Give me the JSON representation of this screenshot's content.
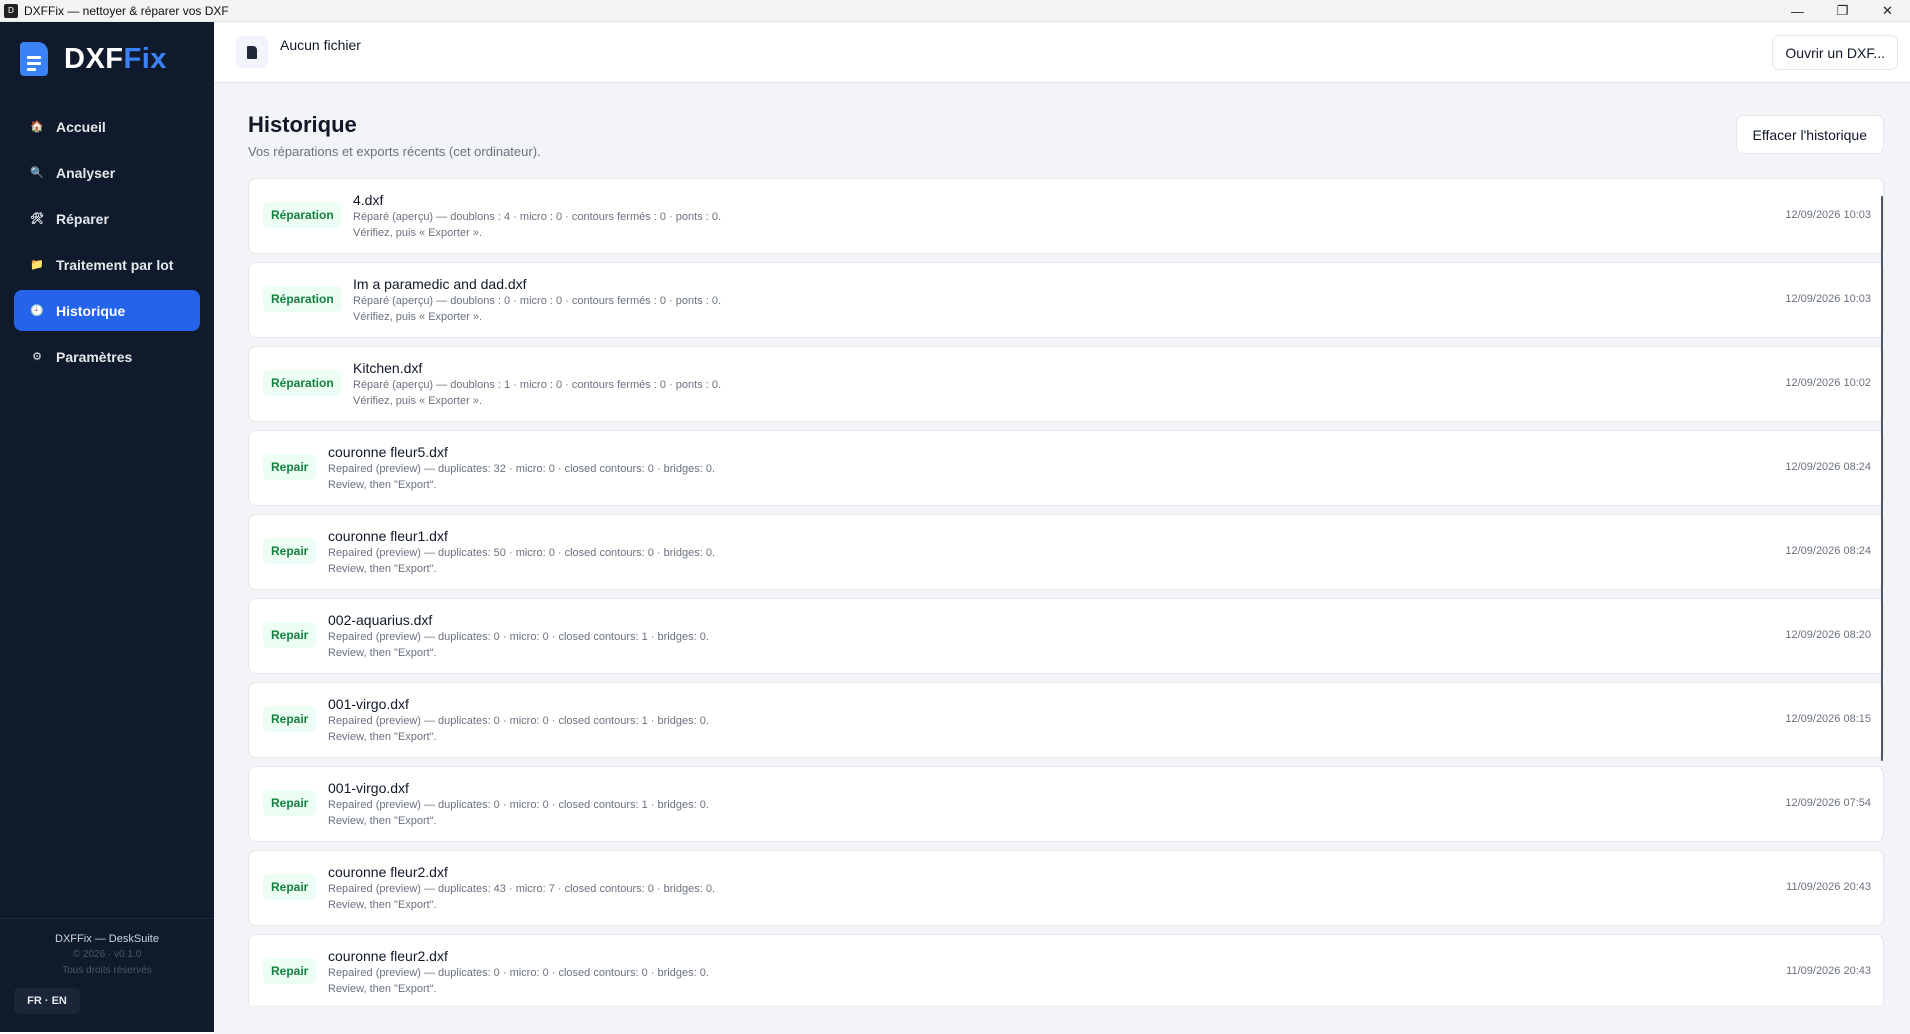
{
  "window": {
    "title": "DXFFix — nettoyer & réparer vos DXF",
    "app_icon": "D",
    "minimize": "—",
    "maximize": "❐",
    "close": "✕"
  },
  "logo": {
    "part1": "DXF",
    "part2": "Fix"
  },
  "nav": [
    {
      "label": "Accueil",
      "icon": "🏠"
    },
    {
      "label": "Analyser",
      "icon": "🔍"
    },
    {
      "label": "Réparer",
      "icon": "🛠"
    },
    {
      "label": "Traitement par lot",
      "icon": "📁"
    },
    {
      "label": "Historique",
      "icon": "🕘",
      "active": true
    },
    {
      "label": "Paramètres",
      "icon": "⚙"
    }
  ],
  "footer": {
    "name": "DXFFix — DeskSuite",
    "version": "© 2026 · v0.1.0",
    "rights": "Tous droits réservés",
    "lang": "FR · EN"
  },
  "topbar": {
    "file_label": "Aucun fichier",
    "open_button": "Ouvrir un DXF..."
  },
  "page": {
    "title": "Historique",
    "subtitle": "Vos réparations et exports récents (cet ordinateur).",
    "clear_button": "Effacer l'historique"
  },
  "history": [
    {
      "badge": "Réparation",
      "file": "4.dxf",
      "line1": "Réparé (aperçu) — doublons : 4 · micro : 0 · contours fermés : 0 · ponts : 0.",
      "line2": "Vérifiez, puis « Exporter ».",
      "time": "12/09/2026 10:03"
    },
    {
      "badge": "Réparation",
      "file": "Im a paramedic and dad.dxf",
      "line1": "Réparé (aperçu) — doublons : 0 · micro : 0 · contours fermés : 0 · ponts : 0.",
      "line2": "Vérifiez, puis « Exporter ».",
      "time": "12/09/2026 10:03"
    },
    {
      "badge": "Réparation",
      "file": "Kitchen.dxf",
      "line1": "Réparé (aperçu) — doublons : 1 · micro : 0 · contours fermés : 0 · ponts : 0.",
      "line2": "Vérifiez, puis « Exporter ».",
      "time": "12/09/2026 10:02"
    },
    {
      "badge": "Repair",
      "file": "couronne fleur5.dxf",
      "line1": "Repaired (preview) — duplicates: 32 · micro: 0 · closed contours: 0 · bridges: 0.",
      "line2": "Review, then \"Export\".",
      "time": "12/09/2026 08:24"
    },
    {
      "badge": "Repair",
      "file": "couronne fleur1.dxf",
      "line1": "Repaired (preview) — duplicates: 50 · micro: 0 · closed contours: 0 · bridges: 0.",
      "line2": "Review, then \"Export\".",
      "time": "12/09/2026 08:24"
    },
    {
      "badge": "Repair",
      "file": "002-aquarius.dxf",
      "line1": "Repaired (preview) — duplicates: 0 · micro: 0 · closed contours: 1 · bridges: 0.",
      "line2": "Review, then \"Export\".",
      "time": "12/09/2026 08:20"
    },
    {
      "badge": "Repair",
      "file": "001-virgo.dxf",
      "line1": "Repaired (preview) — duplicates: 0 · micro: 0 · closed contours: 1 · bridges: 0.",
      "line2": "Review, then \"Export\".",
      "time": "12/09/2026 08:15"
    },
    {
      "badge": "Repair",
      "file": "001-virgo.dxf",
      "line1": "Repaired (preview) — duplicates: 0 · micro: 0 · closed contours: 1 · bridges: 0.",
      "line2": "Review, then \"Export\".",
      "time": "12/09/2026 07:54"
    },
    {
      "badge": "Repair",
      "file": "couronne fleur2.dxf",
      "line1": "Repaired (preview) — duplicates: 43 · micro: 7 · closed contours: 0 · bridges: 0.",
      "line2": "Review, then \"Export\".",
      "time": "11/09/2026 20:43"
    },
    {
      "badge": "Repair",
      "file": "couronne fleur2.dxf",
      "line1": "Repaired (preview) — duplicates: 0 · micro: 0 · closed contours: 0 · bridges: 0.",
      "line2": "Review, then \"Export\".",
      "time": "11/09/2026 20:43"
    }
  ],
  "colors": {
    "sidebar_bg": "#0f1a2c",
    "accent": "#2563eb",
    "badge_bg": "#ecfdf3",
    "badge_text": "#15803d"
  }
}
